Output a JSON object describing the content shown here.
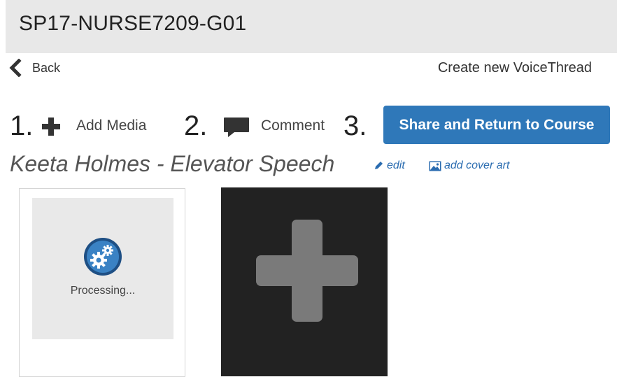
{
  "header": {
    "course_title": "SP17-NURSE7209-G01"
  },
  "nav": {
    "back_label": "Back",
    "create_label": "Create new VoiceThread"
  },
  "steps": [
    {
      "number": "1.",
      "label": "Add Media"
    },
    {
      "number": "2.",
      "label": "Comment"
    },
    {
      "number": "3.",
      "label": "Share and Return to Course"
    }
  ],
  "thread": {
    "title": "Keeta Holmes - Elevator Speech",
    "edit_label": "edit",
    "cover_label": "add cover art"
  },
  "media": [
    {
      "status": "Processing...",
      "icon": "gears-icon"
    }
  ],
  "colors": {
    "primary": "#2f78b9",
    "link": "#2a6cb0",
    "header_bg": "#e8e8e8",
    "add_tile_bg": "#222222"
  }
}
